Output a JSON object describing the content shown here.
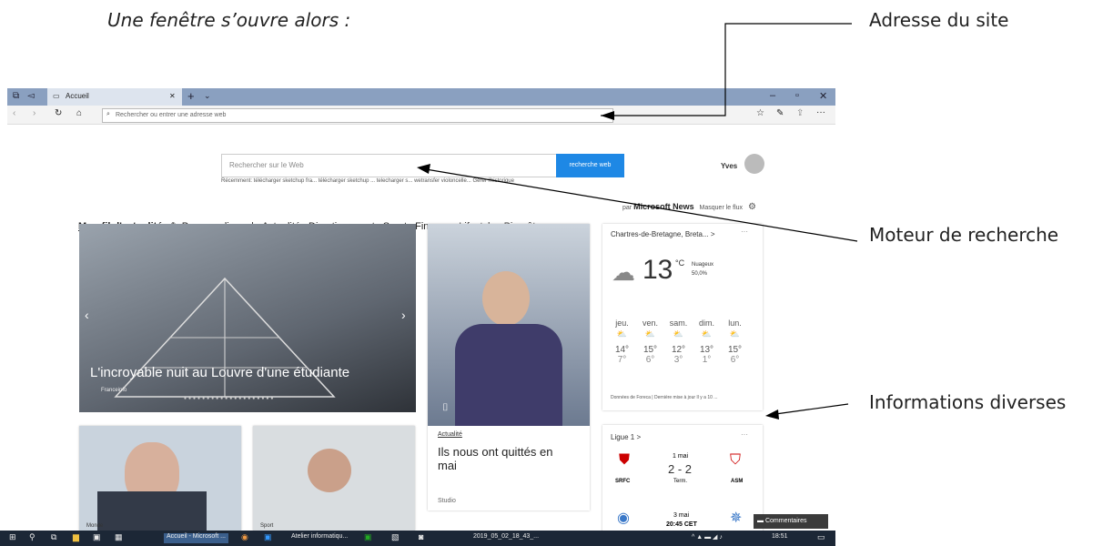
{
  "caption": "Une fenêtre s’ouvre alors :",
  "annotations": {
    "address": "Adresse du site",
    "search": "Moteur de recherche",
    "info": "Informations diverses"
  },
  "browser": {
    "tab_title": "Accueil",
    "address_placeholder": "Rechercher ou entrer une adresse web",
    "search_placeholder": "Rechercher sur le Web",
    "search_button": "recherche web",
    "user": "Yves",
    "recent_line": "Récemment:  télécharger sketchup fra...   télécharger sketchup ...   telecharger s...   wetransfer  violoncelle...  Gérer l'historique",
    "feed_tabs": [
      "Mon fil d'actualité",
      "✎ Personnaliser",
      "|",
      "Actualité",
      "Divertissement",
      "Sport",
      "Finance",
      "Lifestyle",
      "Bien-être",
      "···"
    ],
    "powered_prefix": "par",
    "powered": "Microsoft News",
    "hide_feed": "Masquer le flux",
    "hero_title": "L'incroyable nuit au Louvre d'une étudiante",
    "hero_source": "Franceinfo",
    "card_category": "Actualité",
    "card_title": "Ils nous ont quittés en mai",
    "card_source": "Studio",
    "small_card1_cat": "Monde",
    "small_card2_cat": "Sport"
  },
  "weather": {
    "location": "Chartres-de-Bretagne, Breta...  >",
    "temp": "13",
    "unit": "°C",
    "condition": "Nuageux",
    "humidity": "50,0%",
    "days": [
      "jeu.",
      "ven.",
      "sam.",
      "dim.",
      "lun."
    ],
    "highs": [
      "14°",
      "15°",
      "12°",
      "13°",
      "15°"
    ],
    "lows": [
      "7°",
      "6°",
      "3°",
      "1°",
      "6°"
    ],
    "footer": "Données de Foreca | Dernière mise à jour Il y a 10 ..."
  },
  "ligue": {
    "title": "Ligue 1  >",
    "match1": {
      "date": "1 mai",
      "score": "2 - 2",
      "status": "Term.",
      "home": "SRFC",
      "away": "ASM"
    },
    "match2": {
      "date": "3 mai",
      "time": "20:45 CET"
    }
  },
  "comments_button": "Commentaires",
  "taskbar": {
    "items": [
      "Accueil - Microsoft ...",
      "Atelier informatiqu...",
      "2019_05_02_18_43_..."
    ],
    "time": "18:51"
  },
  "colors": {
    "accent": "#1e88e5",
    "tabbar": "#8aa0c0",
    "taskbar": "#1c2736"
  }
}
